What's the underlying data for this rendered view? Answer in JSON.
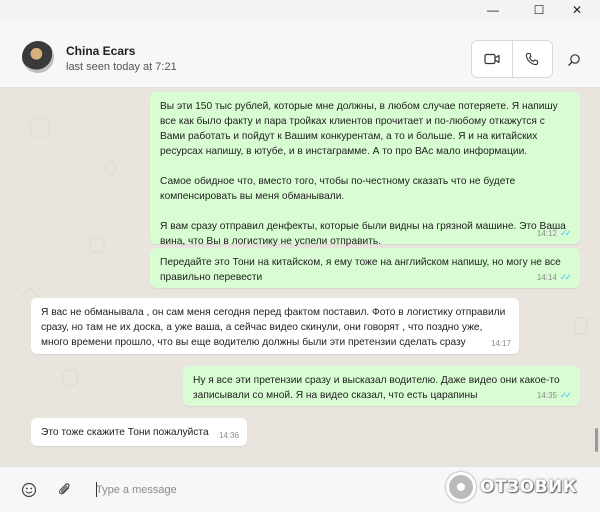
{
  "window": {
    "minimize_glyph": "—",
    "maximize_glyph": "☐",
    "close_glyph": "✕"
  },
  "header": {
    "contact_name": "China Ecars",
    "status": "last seen today at 7:21",
    "icons": [
      "video-call-icon",
      "voice-call-icon",
      "search-icon"
    ]
  },
  "messages": [
    {
      "direction": "out",
      "paragraphs": [
        "Вы эти  150 тыс рублей, которые мне должны, в любом случае потеряете. Я напишу все как было факту и пара тройках клиентов прочитает и по-любому откажутся с Вами работать и пойдут к Вашим конкурентам, а то и больше. Я и на китайских ресурсах напишу, в ютубе, и в инстаграмме. А то про ВАс мало информации.",
        "Самое обидное что, вместо того, чтобы по-честному сказать что не будете компенсировать вы меня обманывали.",
        "Я вам сразу отправил денфекты, которые были видны на грязной машине. Это Ваша вина, что Вы в логистику не успели отправить."
      ],
      "time": "14:12",
      "read": true
    },
    {
      "direction": "out",
      "paragraphs": [
        "Передайте это Тони на китайском, я ему тоже на английском напишу, но могу не все правильно перевести"
      ],
      "time": "14:14",
      "read": true
    },
    {
      "direction": "in",
      "paragraphs": [
        "Я вас не обманывала , он сам меня сегодня перед фактом поставил. Фото в логистику отправили сразу, но там не их доска, а уже ваша, а сейчас видео скинули, они говорят , что поздно уже, много времени прошло, что вы еще водителю должны были эти претензии сделать сразу"
      ],
      "time": "14:17",
      "read": false
    },
    {
      "direction": "out",
      "paragraphs": [
        "Ну я все эти претензии сразу и высказал водителю. Даже видео они какое-то записывали со мной. Я на видео сказал, что есть царапины"
      ],
      "time": "14:35",
      "read": true
    },
    {
      "direction": "in",
      "paragraphs": [
        "Это тоже скажите Тони пожалуйста"
      ],
      "time": "14:36",
      "read": false
    }
  ],
  "composer": {
    "placeholder": "Type a message",
    "icons": [
      "emoji-icon",
      "attach-icon"
    ]
  },
  "watermark": {
    "text": "ОТЗОВИК"
  },
  "colors": {
    "outgoing_bubble": "#d9fdd3",
    "incoming_bubble": "#ffffff",
    "chat_background": "#e9e5de",
    "read_ticks": "#53bdeb"
  }
}
